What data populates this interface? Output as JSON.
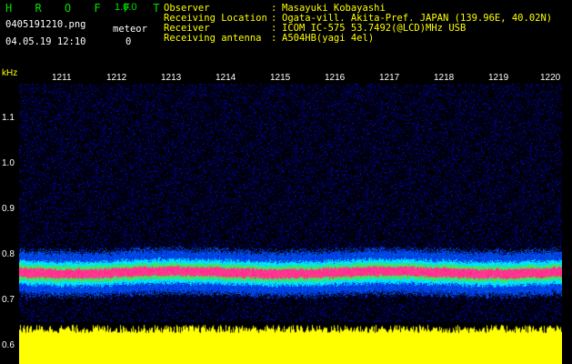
{
  "app": {
    "title": "H R O F F T",
    "version": "1.0.0"
  },
  "file": {
    "name": "0405191210.png",
    "datetime": "04.05.19 12:10"
  },
  "meteor": {
    "label": "meteor",
    "count": "0"
  },
  "info": [
    {
      "label": "Observer",
      "sep": ":",
      "value": "Masayuki Kobayashi"
    },
    {
      "label": "Receiving Location",
      "sep": ":",
      "value": "Ogata-vill. Akita-Pref. JAPAN (139.96E, 40.02N)"
    },
    {
      "label": "Receiver",
      "sep": ":",
      "value": "ICOM IC-575 53.7492(@LCD)MHz USB"
    },
    {
      "label": "Receiving antenna",
      "sep": ":",
      "value": "A504HB(yagi 4el)"
    }
  ],
  "colors": {
    "title": "#00e000",
    "info": "#ffff00",
    "signal": "#ff2090",
    "level_bars": "#ffff00"
  },
  "chart_data": {
    "type": "heatmap",
    "y_unit": "kHz",
    "y_ticks": [
      "1.1",
      "1.0",
      "0.9",
      "0.8",
      "0.7",
      "0.6"
    ],
    "x_ticks": [
      "1211",
      "1212",
      "1213",
      "1214",
      "1215",
      "1216",
      "1217",
      "1218",
      "1219",
      "1220"
    ],
    "signal_center_khz": 0.765
  }
}
